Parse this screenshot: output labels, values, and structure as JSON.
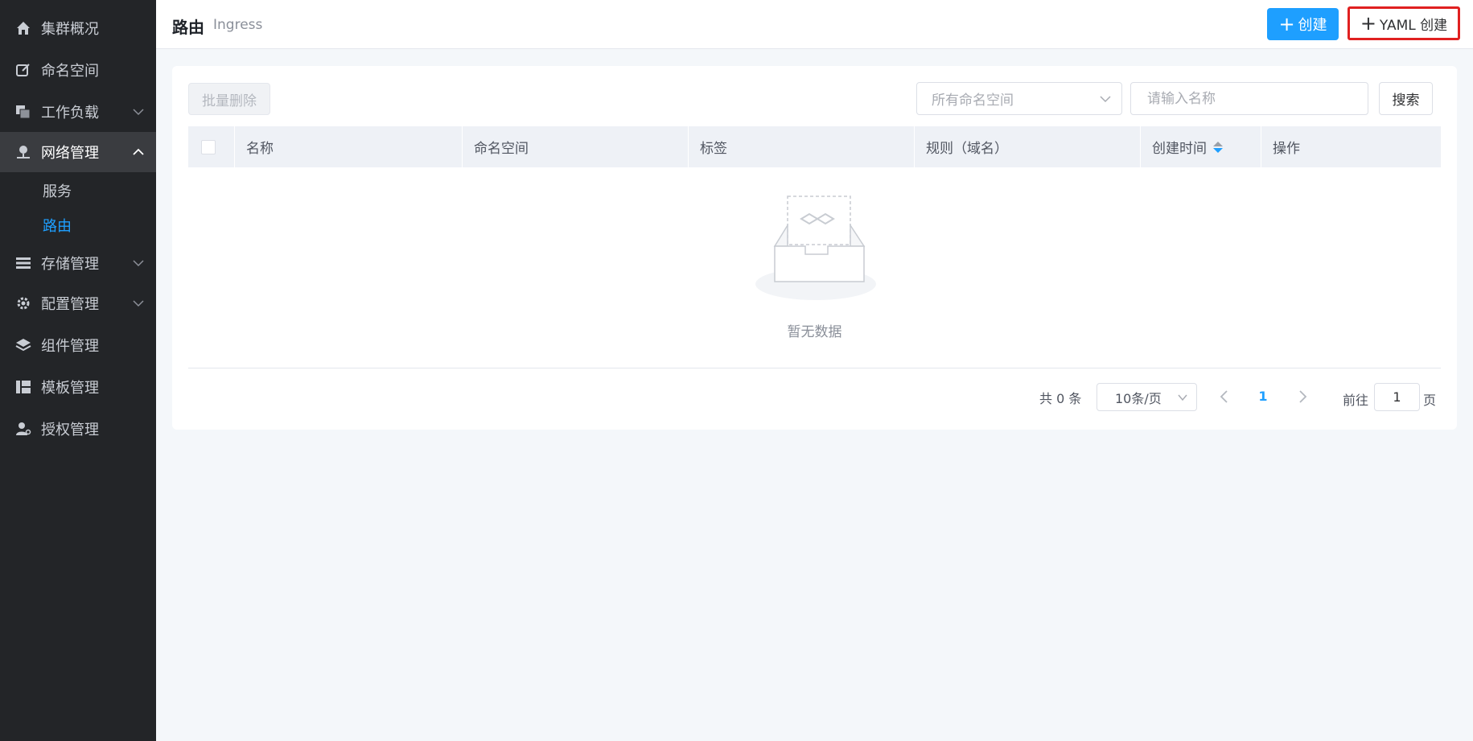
{
  "sidebar": {
    "items": [
      {
        "label": "集群概况",
        "icon": "home-icon"
      },
      {
        "label": "命名空间",
        "icon": "edit-icon"
      },
      {
        "label": "工作负载",
        "icon": "copy-icon"
      },
      {
        "label": "网络管理",
        "icon": "network-icon"
      },
      {
        "label": "存储管理",
        "icon": "storage-icon"
      },
      {
        "label": "配置管理",
        "icon": "gear-icon"
      },
      {
        "label": "组件管理",
        "icon": "layers-icon"
      },
      {
        "label": "模板管理",
        "icon": "template-icon"
      },
      {
        "label": "授权管理",
        "icon": "user-key-icon"
      }
    ],
    "network_sub": [
      {
        "label": "服务"
      },
      {
        "label": "路由"
      }
    ],
    "active": "网络管理",
    "selected_sub": "路由"
  },
  "header": {
    "title": "路由",
    "subtitle": "Ingress",
    "create_label": "创建",
    "yaml_create_label": "YAML 创建"
  },
  "toolbar": {
    "batch_delete_label": "批量删除",
    "namespace_select": "所有命名空间",
    "name_placeholder": "请输入名称",
    "search_label": "搜索"
  },
  "table": {
    "columns": [
      "名称",
      "命名空间",
      "标签",
      "规则（域名）",
      "创建时间",
      "操作"
    ],
    "rows": [],
    "empty_text": "暂无数据"
  },
  "pagination": {
    "total_text": "共 0 条",
    "page_size": "10条/页",
    "current_page": "1",
    "goto_label": "前往",
    "goto_value": "1",
    "page_unit": "页"
  },
  "colors": {
    "sidebar_bg": "#232528",
    "primary": "#1e9fff",
    "highlight_border": "#e02020"
  }
}
